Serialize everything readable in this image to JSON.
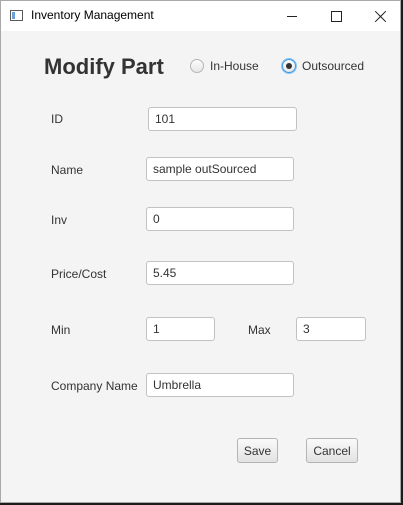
{
  "window": {
    "title": "Inventory Management"
  },
  "form": {
    "title": "Modify Part",
    "source_options": [
      {
        "label": "In-House",
        "selected": false
      },
      {
        "label": "Outsourced",
        "selected": true
      }
    ],
    "fields": {
      "id": {
        "label": "ID",
        "value": "101"
      },
      "name": {
        "label": "Name",
        "value": "sample outSourced"
      },
      "inv": {
        "label": "Inv",
        "value": "0"
      },
      "price": {
        "label": "Price/Cost",
        "value": "5.45"
      },
      "min": {
        "label": "Min",
        "value": "1"
      },
      "max": {
        "label": "Max",
        "value": "3"
      },
      "company": {
        "label": "Company Name",
        "value": "Umbrella"
      }
    },
    "buttons": {
      "save": "Save",
      "cancel": "Cancel"
    }
  }
}
